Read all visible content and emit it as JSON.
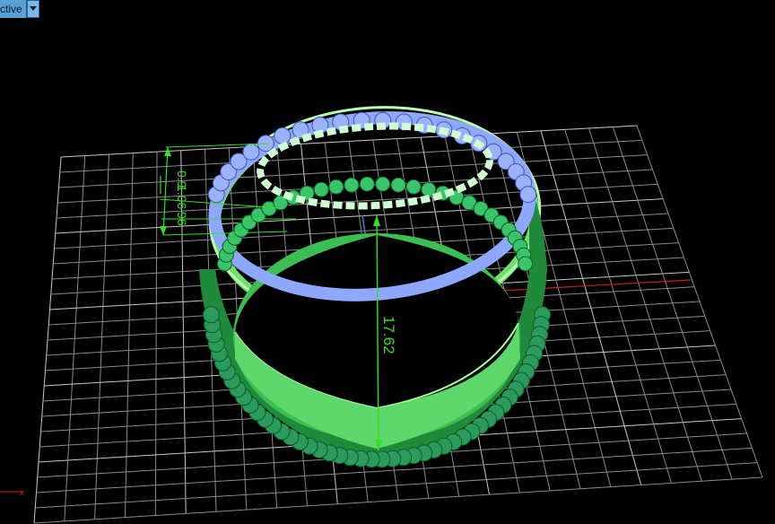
{
  "viewport": {
    "view_label": "ctive",
    "icon": "chevron-down-icon"
  },
  "dimensions": {
    "ring_height": "17.62",
    "gap_height": "1.06",
    "band_top": "0.9",
    "band_bottom": "96"
  },
  "colors": {
    "background": "#000000",
    "grid": "#9a9a9a",
    "x_axis": "#c82020",
    "y_axis": "#3a7fc0",
    "ring": "#6ee06a",
    "ring_dark": "#1f8a3a",
    "bead": "#2a9b5a",
    "stone": "#8fa8ff",
    "dimension": "#34e020"
  }
}
